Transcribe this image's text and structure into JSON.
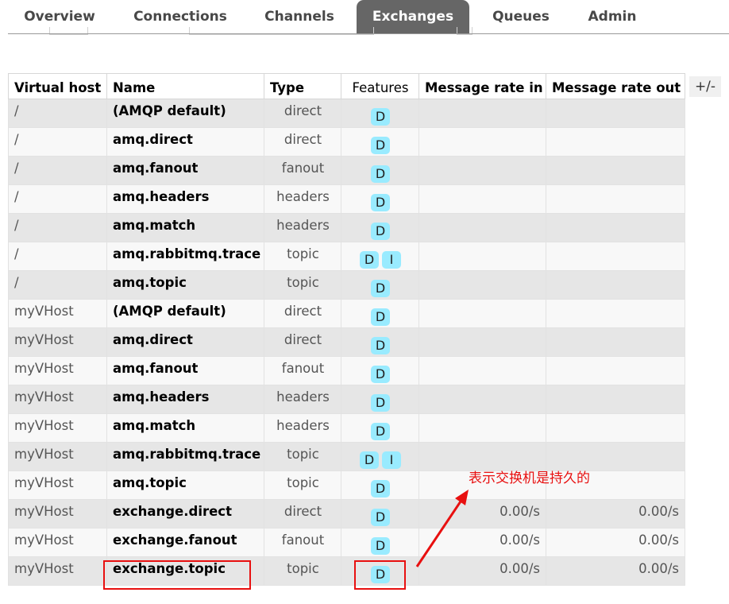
{
  "nav": {
    "tabs": [
      {
        "label": "Overview",
        "active": false
      },
      {
        "label": "Connections",
        "active": false
      },
      {
        "label": "Channels",
        "active": false
      },
      {
        "label": "Exchanges",
        "active": true
      },
      {
        "label": "Queues",
        "active": false
      },
      {
        "label": "Admin",
        "active": false
      }
    ]
  },
  "table": {
    "headers": [
      "Virtual host",
      "Name",
      "Type",
      "Features",
      "Message rate in",
      "Message rate out"
    ],
    "toggle_columns_label": "+/-",
    "rows": [
      {
        "vhost": "/",
        "name": "(AMQP default)",
        "type": "direct",
        "features": [
          "D"
        ],
        "rate_in": "",
        "rate_out": ""
      },
      {
        "vhost": "/",
        "name": "amq.direct",
        "type": "direct",
        "features": [
          "D"
        ],
        "rate_in": "",
        "rate_out": ""
      },
      {
        "vhost": "/",
        "name": "amq.fanout",
        "type": "fanout",
        "features": [
          "D"
        ],
        "rate_in": "",
        "rate_out": ""
      },
      {
        "vhost": "/",
        "name": "amq.headers",
        "type": "headers",
        "features": [
          "D"
        ],
        "rate_in": "",
        "rate_out": ""
      },
      {
        "vhost": "/",
        "name": "amq.match",
        "type": "headers",
        "features": [
          "D"
        ],
        "rate_in": "",
        "rate_out": ""
      },
      {
        "vhost": "/",
        "name": "amq.rabbitmq.trace",
        "type": "topic",
        "features": [
          "D",
          "I"
        ],
        "rate_in": "",
        "rate_out": ""
      },
      {
        "vhost": "/",
        "name": "amq.topic",
        "type": "topic",
        "features": [
          "D"
        ],
        "rate_in": "",
        "rate_out": ""
      },
      {
        "vhost": "myVHost",
        "name": "(AMQP default)",
        "type": "direct",
        "features": [
          "D"
        ],
        "rate_in": "",
        "rate_out": ""
      },
      {
        "vhost": "myVHost",
        "name": "amq.direct",
        "type": "direct",
        "features": [
          "D"
        ],
        "rate_in": "",
        "rate_out": ""
      },
      {
        "vhost": "myVHost",
        "name": "amq.fanout",
        "type": "fanout",
        "features": [
          "D"
        ],
        "rate_in": "",
        "rate_out": ""
      },
      {
        "vhost": "myVHost",
        "name": "amq.headers",
        "type": "headers",
        "features": [
          "D"
        ],
        "rate_in": "",
        "rate_out": ""
      },
      {
        "vhost": "myVHost",
        "name": "amq.match",
        "type": "headers",
        "features": [
          "D"
        ],
        "rate_in": "",
        "rate_out": ""
      },
      {
        "vhost": "myVHost",
        "name": "amq.rabbitmq.trace",
        "type": "topic",
        "features": [
          "D",
          "I"
        ],
        "rate_in": "",
        "rate_out": ""
      },
      {
        "vhost": "myVHost",
        "name": "amq.topic",
        "type": "topic",
        "features": [
          "D"
        ],
        "rate_in": "",
        "rate_out": ""
      },
      {
        "vhost": "myVHost",
        "name": "exchange.direct",
        "type": "direct",
        "features": [
          "D"
        ],
        "rate_in": "0.00/s",
        "rate_out": "0.00/s"
      },
      {
        "vhost": "myVHost",
        "name": "exchange.fanout",
        "type": "fanout",
        "features": [
          "D"
        ],
        "rate_in": "0.00/s",
        "rate_out": "0.00/s"
      },
      {
        "vhost": "myVHost",
        "name": "exchange.topic",
        "type": "topic",
        "features": [
          "D"
        ],
        "rate_in": "0.00/s",
        "rate_out": "0.00/s"
      }
    ]
  },
  "annotation": {
    "text": "表示交换机是持久的",
    "color": "#e81010"
  },
  "colors": {
    "active_tab_bg": "#666666",
    "feature_badge_bg": "#99ebff",
    "row_odd_bg": "#e6e6e6",
    "row_even_bg": "#f8f8f8"
  }
}
